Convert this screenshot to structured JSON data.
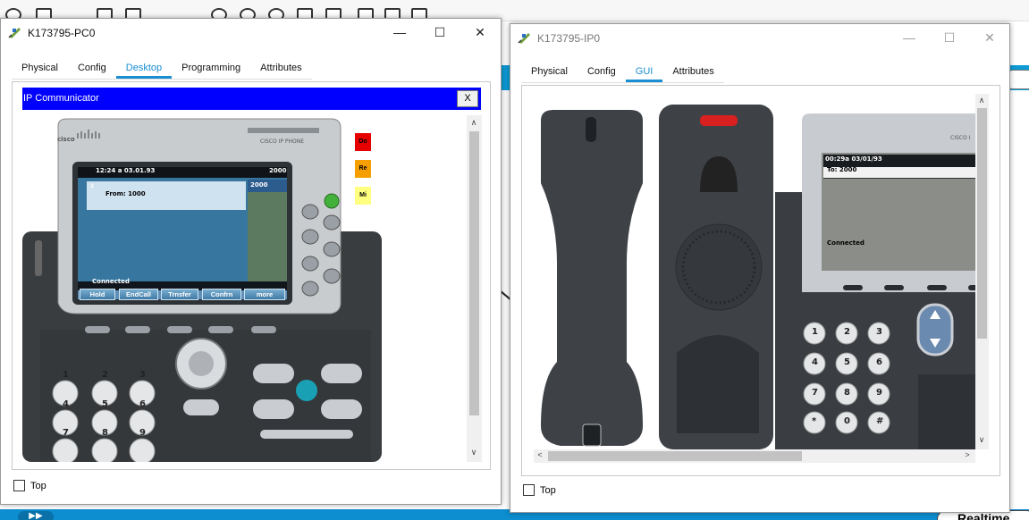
{
  "pc_window": {
    "title": "K173795-PC0",
    "tabs": [
      {
        "label": "Physical",
        "active": false
      },
      {
        "label": "Config",
        "active": false
      },
      {
        "label": "Desktop",
        "active": true
      },
      {
        "label": "Programming",
        "active": false
      },
      {
        "label": "Attributes",
        "active": false
      }
    ],
    "app_title": "IP Communicator",
    "app_close": "X",
    "side_buttons": [
      "Do",
      "Re",
      "Mi"
    ],
    "side_button_colors": [
      "#e60000",
      "#f5a000",
      "#ffff80"
    ],
    "phone": {
      "brand": "CISCO IP PHONE",
      "logo": "cisco",
      "time_date": "12:24 a  03.01.93",
      "ext": "2000",
      "line_ext": "2000",
      "line_num": "1",
      "call_from": "From: 1000",
      "status": "Connected",
      "softkeys": [
        "Hold",
        "EndCall",
        "Trnsfer",
        "Confrn",
        "more"
      ],
      "keys": [
        "1",
        "2",
        "3",
        "4",
        "5",
        "6",
        "7",
        "8",
        "9"
      ]
    },
    "top_label": "Top"
  },
  "ip_window": {
    "title": "K173795-IP0",
    "tabs": [
      {
        "label": "Physical",
        "active": false
      },
      {
        "label": "Config",
        "active": false
      },
      {
        "label": "GUI",
        "active": true
      },
      {
        "label": "Attributes",
        "active": false
      }
    ],
    "phone": {
      "brand": "CISCO I",
      "time_date": "00:29a 03/01/93",
      "to": "To: 2000",
      "status": "Connected",
      "keys": [
        "1",
        "2",
        "3",
        "4",
        "5",
        "6",
        "7",
        "8",
        "9",
        "*",
        "0",
        "#"
      ]
    },
    "top_label": "Top"
  },
  "window_controls": {
    "minimize": "—",
    "maximize": "☐",
    "close": "✕"
  },
  "background": {
    "realtime": "Realtime"
  },
  "colors": {
    "accent": "#1a8ed3",
    "app_header": "#0000ff",
    "bg_bar": "#0d9bd6"
  }
}
